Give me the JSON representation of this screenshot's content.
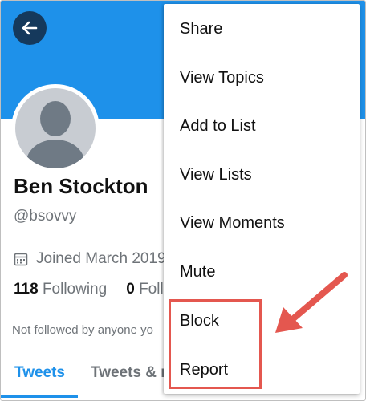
{
  "profile": {
    "name": "Ben Stockton",
    "handle": "@bsovvy",
    "joined": "Joined March 2019",
    "following_count": "118",
    "following_label": "Following",
    "followers_count": "0",
    "followers_label": "Foll",
    "not_followed_text": "Not followed by anyone yo"
  },
  "tabs": {
    "tweets": "Tweets",
    "tweets_replies": "Tweets & re"
  },
  "menu": {
    "items": [
      "Share",
      "View Topics",
      "Add to List",
      "View Lists",
      "View Moments",
      "Mute",
      "Block",
      "Report"
    ]
  },
  "colors": {
    "banner": "#1e91ea",
    "accent": "#1e91ea",
    "back_button": "#15395c",
    "annotation": "#e4574f"
  },
  "icons": {
    "back": "arrow-left-icon",
    "calendar": "calendar-icon"
  }
}
